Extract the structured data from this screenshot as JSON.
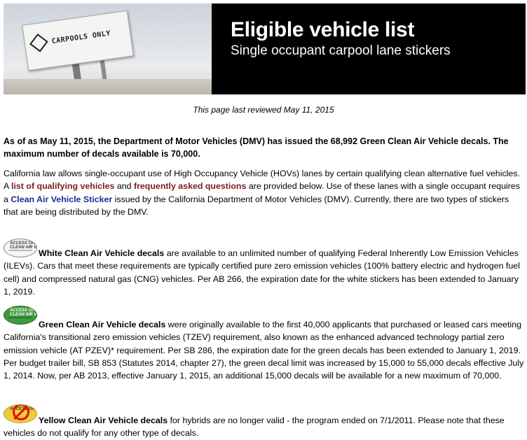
{
  "banner": {
    "sign_text": "CARPOOLS ONLY",
    "title": "Eligible vehicle list",
    "subtitle": "Single occupant carpool lane stickers"
  },
  "reviewed": "This page last reviewed May 11, 2015",
  "lead": "As of as May 11, 2015, the Department of Motor Vehicles (DMV) has issued the 68,992 Green Clean Air Vehicle decals. The maximum number of decals available is 70,000.",
  "intro": {
    "t1": "California law allows single-occupant use of High Occupancy Vehicle (HOVs) lanes by certain qualifying clean alternative fuel vehicles. A ",
    "link1": "list of qualifying vehicles",
    "t2": " and ",
    "link2": "frequently asked questions",
    "t3": " are provided below. Use of these lanes with a single occupant requires a ",
    "link3": "Clean Air Vehicle Sticker",
    "t4": " issued by the California Department of Motor Vehicles (DMV). Currently, there are two types of stickers that are being distributed by the DMV."
  },
  "white": {
    "decal_text": "ACCESS OK / CLEAN AIR VEHICLE",
    "heading": "White Clean Air Vehicle decals",
    "body": " are available to an unlimited number of qualifying Federal Inherently Low Emission Vehicles (ILEVs). Cars that meet these requirements are typically certified pure zero emission vehicles (100% battery electric and hydrogen fuel cell) and compressed natural gas (CNG) vehicles. Per AB 266, the expiration date for the white stickers has been extended to January 1, 2019."
  },
  "green": {
    "decal_text": "ACCESS OK / CLEAN AIR VEHICLE",
    "heading": "Green Clean Air Vehicle decals",
    "body": " were originally available to the first 40,000 applicants that purchased or leased cars meeting California's transitional zero emission vehicles (TZEV) requirement, also known as the enhanced advanced technology partial zero emission vehicle (AT PZEV)* requirement. Per SB 286, the expiration date for the green decals has been extended to January 1, 2019. Per budget trailer bill, SB 853 (Statutes 2014, chapter 27), the green decal limit was increased by 15,000 to 55,000 decals effective July 1, 2014. Now, per AB 2013, effective January 1, 2015, an additional 15,000 decals will be available for a new maximum of 70,000."
  },
  "yellow": {
    "heading": "Yellow Clean Air Vehicle decals",
    "body": " for hybrids are no longer valid - the program ended on 7/1/2011. Please note that these vehicles do not qualify for any other type of decals."
  }
}
